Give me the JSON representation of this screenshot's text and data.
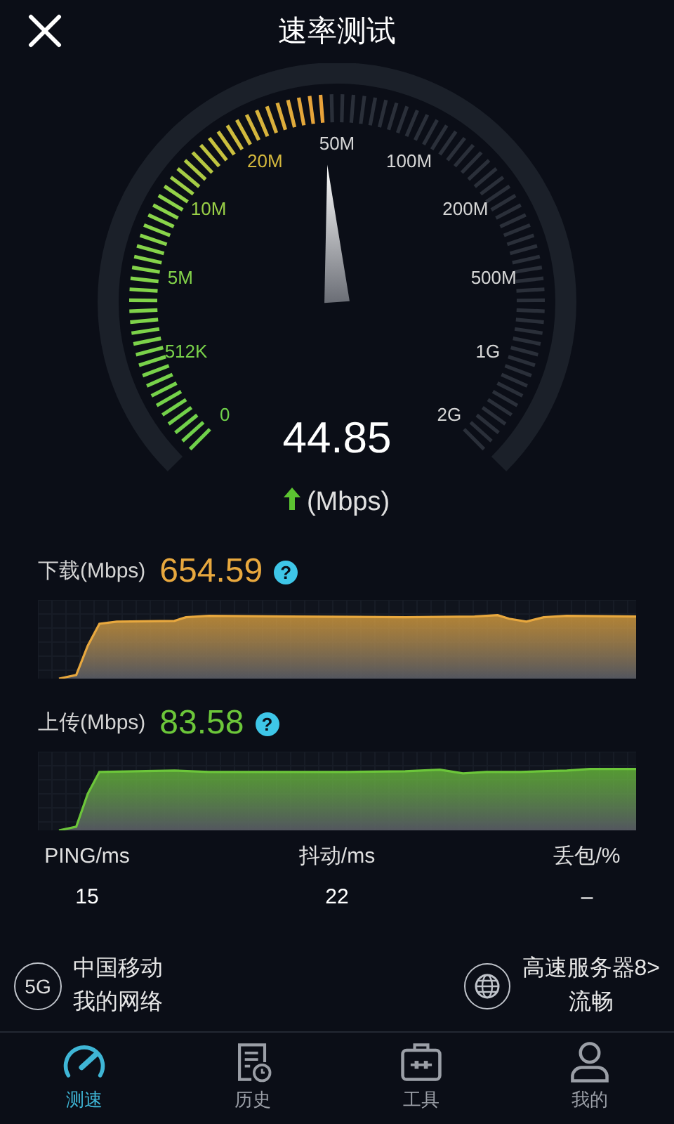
{
  "header": {
    "title": "速率测试"
  },
  "gauge": {
    "scale": [
      "0",
      "512K",
      "5M",
      "10M",
      "20M",
      "50M",
      "100M",
      "200M",
      "500M",
      "1G",
      "2G"
    ],
    "value": "44.85",
    "unit": "(Mbps)"
  },
  "results": [
    {
      "label": "下载(Mbps)",
      "value": "654.59",
      "help": "?",
      "color": "#e8a83e"
    },
    {
      "label": "上传(Mbps)",
      "value": "83.58",
      "help": "?",
      "color": "#6cc63a"
    }
  ],
  "stats": [
    {
      "label": "PING/ms",
      "value": "15"
    },
    {
      "label": "抖动/ms",
      "value": "22"
    },
    {
      "label": "丢包/%",
      "value": "–"
    }
  ],
  "network": {
    "badge": "5G",
    "operator": "中国移动",
    "name": "我的网络"
  },
  "server": {
    "name": "高速服务器8>",
    "status": "流畅"
  },
  "nav": [
    {
      "label": "测速",
      "selected": true
    },
    {
      "label": "历史",
      "selected": false
    },
    {
      "label": "工具",
      "selected": false
    },
    {
      "label": "我的",
      "selected": false
    }
  ]
}
